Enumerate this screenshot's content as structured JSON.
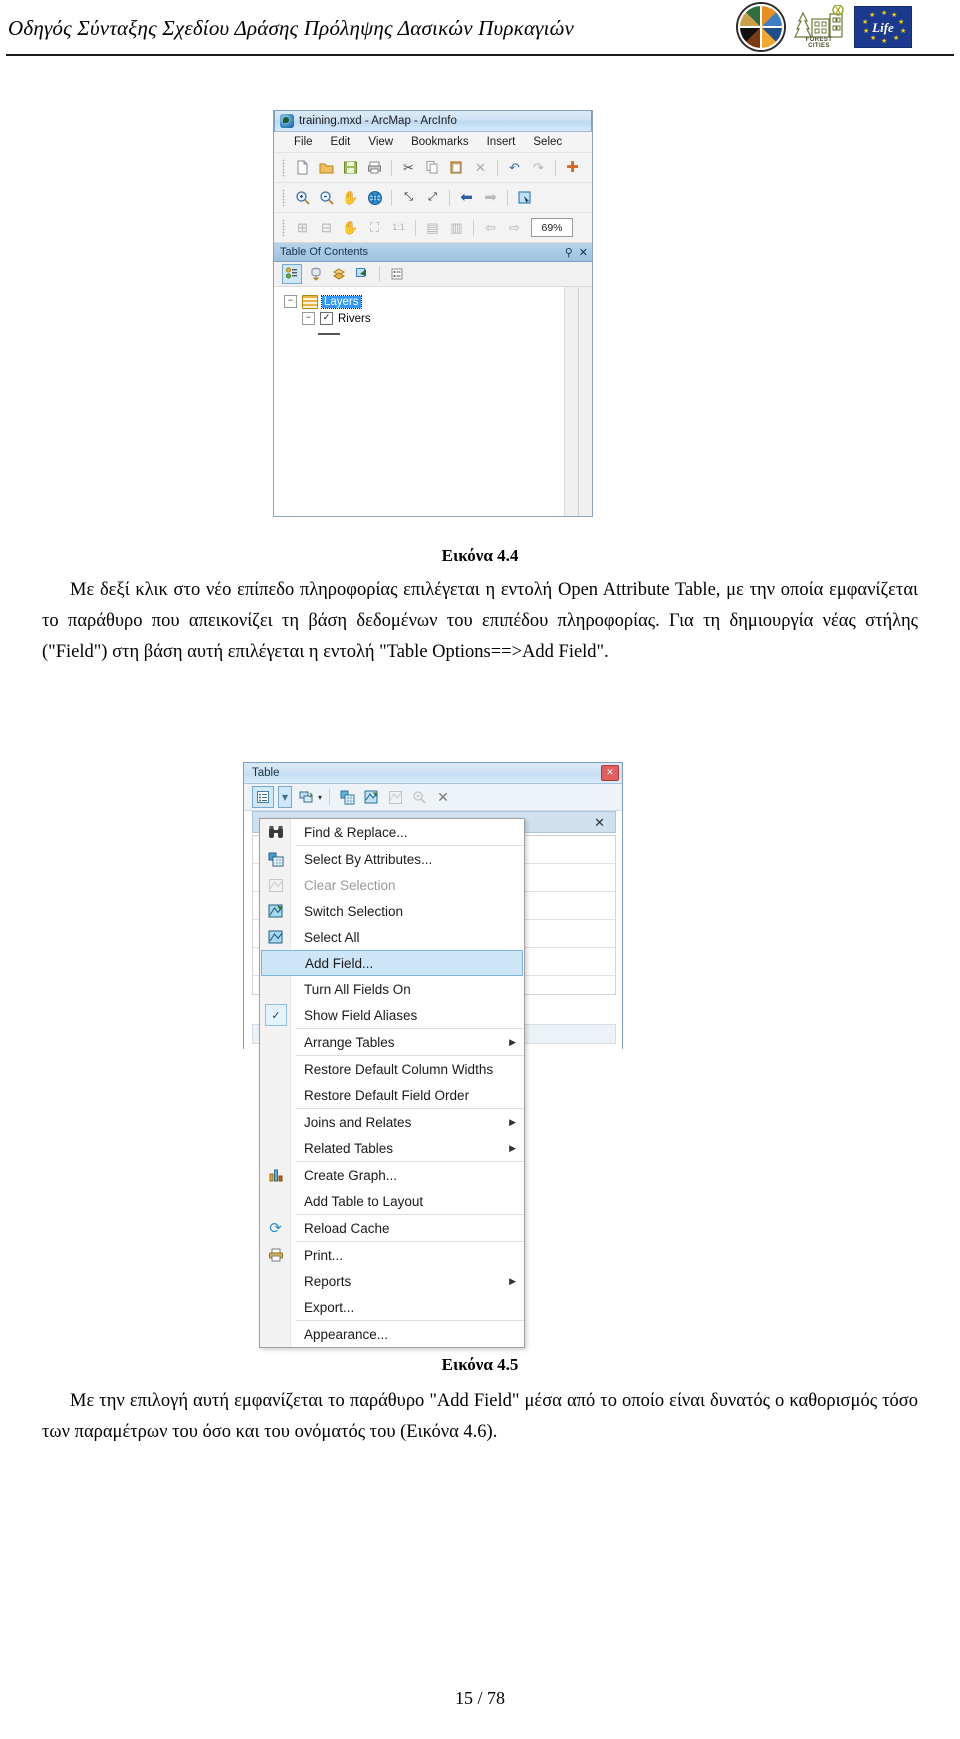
{
  "header": {
    "title": "Οδηγός Σύνταξης Σχεδίου Δράσης Πρόληψης Δασικών Πυρκαγιών",
    "logos": {
      "forest_circle": "forest-circle-logo",
      "forest_cities_line1": "FOREST",
      "forest_cities_line2": "CITIES",
      "eu_life": "Life"
    }
  },
  "figure1": {
    "window_title": "training.mxd - ArcMap - ArcInfo",
    "title_icon": "arcmap-globe-icon",
    "menus": [
      "File",
      "Edit",
      "View",
      "Bookmarks",
      "Insert",
      "Selec"
    ],
    "toolbar1": [
      {
        "name": "new-document-icon",
        "glyph": "🗋"
      },
      {
        "name": "open-folder-icon",
        "glyph": "📂"
      },
      {
        "name": "save-icon",
        "glyph": "💾"
      },
      {
        "name": "print-icon",
        "glyph": "🖶"
      },
      {
        "name": "cut-scissors-icon",
        "glyph": "✂"
      },
      {
        "name": "copy-icon",
        "glyph": "⧉"
      },
      {
        "name": "paste-icon",
        "glyph": "📋"
      },
      {
        "name": "delete-x-icon",
        "glyph": "✕"
      },
      {
        "name": "undo-icon",
        "glyph": "↶"
      },
      {
        "name": "redo-icon",
        "glyph": "↷"
      },
      {
        "name": "add-data-plus-icon",
        "glyph": "✚"
      }
    ],
    "toolbar2": [
      {
        "name": "zoom-in-icon",
        "glyph": "⊕"
      },
      {
        "name": "zoom-out-icon",
        "glyph": "⊖"
      },
      {
        "name": "pan-hand-icon",
        "glyph": "✋"
      },
      {
        "name": "full-extent-globe-icon",
        "glyph": "🌐"
      },
      {
        "name": "fixed-zoom-in-icon",
        "glyph": "⤡"
      },
      {
        "name": "fixed-zoom-out-icon",
        "glyph": "⤢"
      },
      {
        "name": "previous-extent-icon",
        "glyph": "⬅"
      },
      {
        "name": "next-extent-icon",
        "glyph": "➡"
      },
      {
        "name": "select-features-icon",
        "glyph": "⬚"
      }
    ],
    "toolbar3": [
      {
        "name": "page-zoom-in-icon",
        "glyph": "⊞"
      },
      {
        "name": "page-zoom-out-icon",
        "glyph": "⊟"
      },
      {
        "name": "page-pan-icon",
        "glyph": "✋"
      },
      {
        "name": "page-full-extent-icon",
        "glyph": "⛶"
      },
      {
        "name": "page-1to1-icon",
        "glyph": "⊡"
      },
      {
        "name": "page-fixed-zoom-in-icon",
        "glyph": "▤"
      },
      {
        "name": "page-fixed-zoom-out-icon",
        "glyph": "▥"
      },
      {
        "name": "page-back-icon",
        "glyph": "⇦"
      },
      {
        "name": "page-forward-icon",
        "glyph": "⇨"
      }
    ],
    "zoom_value": "69%",
    "toc": {
      "panel_title": "Table Of Contents",
      "pin_icon": "pin-icon",
      "close_icon": "close-icon",
      "buttons": [
        {
          "name": "list-by-drawing-order-icon",
          "glyph": "▤"
        },
        {
          "name": "list-by-source-icon",
          "glyph": "⛁"
        },
        {
          "name": "list-by-visibility-icon",
          "glyph": "◇"
        },
        {
          "name": "list-by-selection-icon",
          "glyph": "◪"
        },
        {
          "name": "options-icon",
          "glyph": "☰"
        }
      ],
      "tree": [
        {
          "label": "Layers",
          "selected": true,
          "expander": "−"
        },
        {
          "label": "Rivers",
          "selected": false,
          "expander": "−",
          "checked": "✓"
        }
      ]
    }
  },
  "caption1": "Εικόνα 4.4",
  "paragraph1": "Με δεξί κλικ στο νέο επίπεδο πληροφορίας επιλέγεται η εντολή Open Attribute Table, με την οποία εμφανίζεται το παράθυρο που απεικονίζει τη βάση δεδομένων του επιπέδου πληροφορίας. Για τη δημιουργία νέας στήλης (\"Field\") στη βάση αυτή επιλέγεται η εντολή \"Table Options==>Add Field\".",
  "figure2": {
    "window_title": "Table",
    "close_button": "✕",
    "toolbar": [
      {
        "name": "table-options-icon",
        "glyph": "▤"
      },
      {
        "name": "table-options-dropdown-icon",
        "glyph": "▾"
      },
      {
        "name": "related-tables-icon",
        "glyph": "⧉"
      },
      {
        "name": "related-tables-dropdown-icon",
        "glyph": "▾"
      },
      {
        "name": "select-by-attributes-icon",
        "glyph": "▣"
      },
      {
        "name": "switch-selection-icon",
        "glyph": "⇄"
      },
      {
        "name": "clear-selection-icon",
        "glyph": "⬚"
      },
      {
        "name": "zoom-to-selected-icon",
        "glyph": "⊕"
      },
      {
        "name": "delete-selected-icon",
        "glyph": "✕"
      }
    ],
    "menu_items": [
      {
        "label": "Find & Replace...",
        "icon": "binoculars-icon",
        "glyph": "👓",
        "state": "normal",
        "separator_after": true
      },
      {
        "label": "Select By Attributes...",
        "icon": "select-by-attributes-icon",
        "glyph": "▣",
        "state": "normal"
      },
      {
        "label": "Clear Selection",
        "icon": "clear-selection-icon",
        "glyph": "⬚",
        "state": "disabled"
      },
      {
        "label": "Switch Selection",
        "icon": "switch-selection-icon",
        "glyph": "⇄",
        "state": "normal"
      },
      {
        "label": "Select All",
        "icon": "select-all-icon",
        "glyph": "◪",
        "state": "normal"
      },
      {
        "label": "Add Field...",
        "icon": "",
        "glyph": "",
        "state": "highlight"
      },
      {
        "label": "Turn All Fields On",
        "icon": "",
        "glyph": "",
        "state": "normal"
      },
      {
        "label": "Show Field Aliases",
        "icon": "checkbox-checked-icon",
        "glyph": "✓",
        "state": "checked",
        "separator_after": true
      },
      {
        "label": "Arrange Tables",
        "icon": "",
        "glyph": "",
        "state": "submenu",
        "arrow": "▶",
        "separator_after": true
      },
      {
        "label": "Restore Default Column Widths",
        "icon": "",
        "glyph": "",
        "state": "normal"
      },
      {
        "label": "Restore Default Field Order",
        "icon": "",
        "glyph": "",
        "state": "normal",
        "separator_after": true
      },
      {
        "label": "Joins and Relates",
        "icon": "",
        "glyph": "",
        "state": "submenu",
        "arrow": "▶"
      },
      {
        "label": "Related Tables",
        "icon": "",
        "glyph": "",
        "state": "submenu",
        "arrow": "▶",
        "separator_after": true
      },
      {
        "label": "Create Graph...",
        "icon": "bar-chart-icon",
        "glyph": "▥",
        "state": "normal"
      },
      {
        "label": "Add Table to Layout",
        "icon": "",
        "glyph": "",
        "state": "normal",
        "separator_after": true
      },
      {
        "label": "Reload Cache",
        "icon": "refresh-icon",
        "glyph": "⟳",
        "state": "normal",
        "separator_after": true
      },
      {
        "label": "Print...",
        "icon": "printer-icon",
        "glyph": "🖶",
        "state": "normal"
      },
      {
        "label": "Reports",
        "icon": "",
        "glyph": "",
        "state": "submenu",
        "arrow": "▶"
      },
      {
        "label": "Export...",
        "icon": "",
        "glyph": "",
        "state": "normal",
        "separator_after": true
      },
      {
        "label": "Appearance...",
        "icon": "",
        "glyph": "",
        "state": "normal"
      }
    ]
  },
  "caption2": "Εικόνα 4.5",
  "paragraph2": "Με την επιλογή αυτή εμφανίζεται το παράθυρο \"Add Field\" μέσα από το οποίο είναι δυνατός ο καθορισμός τόσο των παραμέτρων του όσο και του ονόματός του (Εικόνα 4.6).",
  "footer": {
    "page": "15 / 78"
  }
}
